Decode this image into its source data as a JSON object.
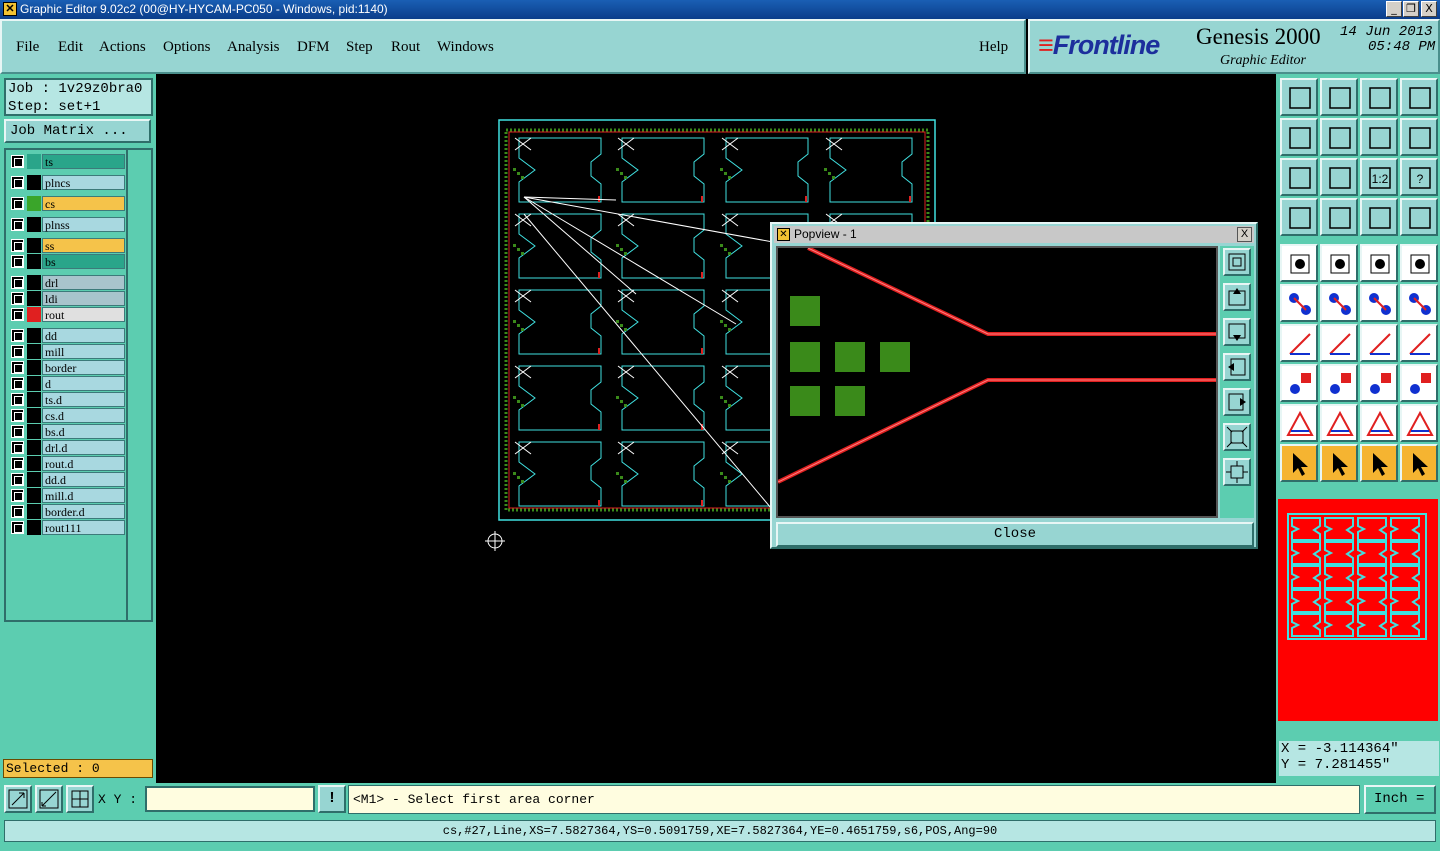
{
  "window": {
    "title": "Graphic Editor 9.02c2 (00@HY-HYCAM-PC050 - Windows, pid:1140)",
    "min": "_",
    "restore": "❐",
    "close": "X"
  },
  "menu": {
    "items": [
      "File",
      "Edit",
      "Actions",
      "Options",
      "Analysis",
      "DFM",
      "Step",
      "Rout",
      "Windows"
    ],
    "help": "Help"
  },
  "brand": {
    "logo": "Frontline",
    "product": "Genesis 2000",
    "subtitle": "Graphic Editor",
    "date": "14 Jun 2013",
    "time": "05:48 PM"
  },
  "job": {
    "job_line": "Job : 1v29z0bra0",
    "step_line": "Step: set+1",
    "matrix_label": "Job Matrix ..."
  },
  "layers": [
    {
      "name": "ts",
      "color": "#2aa58a",
      "name_bg": "#2aa58a"
    },
    {
      "name": "plncs",
      "color": "#000000",
      "name_bg": "#a8d8e0"
    },
    {
      "name": "cs",
      "color": "#3aa52a",
      "name_bg": "#f5c34a"
    },
    {
      "name": "plnss",
      "color": "#000000",
      "name_bg": "#a8d8e0"
    },
    {
      "name": "ss",
      "color": "#000000",
      "name_bg": "#f5c34a"
    },
    {
      "name": "bs",
      "color": "#000000",
      "name_bg": "#2aa58a"
    },
    {
      "name": "drl",
      "color": "#000000",
      "name_bg": "#a8c4cc"
    },
    {
      "name": "ldi",
      "color": "#000000",
      "name_bg": "#a8c4cc"
    },
    {
      "name": "rout",
      "color": "#e02020",
      "name_bg": "#e0e0e0"
    },
    {
      "name": "dd",
      "color": "#000000",
      "name_bg": "#a8d8e0"
    },
    {
      "name": "mill",
      "color": "#000000",
      "name_bg": "#a8d8e0"
    },
    {
      "name": "border",
      "color": "#000000",
      "name_bg": "#a8d8e0"
    },
    {
      "name": "d",
      "color": "#000000",
      "name_bg": "#a8d8e0"
    },
    {
      "name": "ts.d",
      "color": "#000000",
      "name_bg": "#a8d8e0"
    },
    {
      "name": "cs.d",
      "color": "#000000",
      "name_bg": "#a8d8e0"
    },
    {
      "name": "bs.d",
      "color": "#000000",
      "name_bg": "#a8d8e0"
    },
    {
      "name": "drl.d",
      "color": "#000000",
      "name_bg": "#a8d8e0"
    },
    {
      "name": "rout.d",
      "color": "#000000",
      "name_bg": "#a8d8e0"
    },
    {
      "name": "dd.d",
      "color": "#000000",
      "name_bg": "#a8d8e0"
    },
    {
      "name": "mill.d",
      "color": "#000000",
      "name_bg": "#a8d8e0"
    },
    {
      "name": "border.d",
      "color": "#000000",
      "name_bg": "#a8d8e0"
    },
    {
      "name": "rout111",
      "color": "#000000",
      "name_bg": "#a8d8e0"
    }
  ],
  "selected": "Selected : 0",
  "popup": {
    "title": "Popview - 1",
    "close_label": "Close",
    "x_label": "X"
  },
  "coords": {
    "x": "X = -3.114364\"",
    "y": "Y = 7.281455\""
  },
  "bottom": {
    "xy_label": "X Y :",
    "xy_value": "",
    "warn": "!",
    "prompt": "<M1> - Select first area corner",
    "unit": "Inch ="
  },
  "status": "cs,#27,Line,XS=7.5827364,YS=0.5091759,XE=7.5827364,YE=0.4651759,s6,POS,Ang=90",
  "toolbar_ratio_label": "1:2",
  "toolbar_help_label": "?",
  "colors": {
    "panel": "#5ccdb0",
    "button": "#97d5d2",
    "canvas": "#000000",
    "outline": "#40e0e0",
    "rout": "#e02020",
    "pad": "#3a8a1a"
  }
}
